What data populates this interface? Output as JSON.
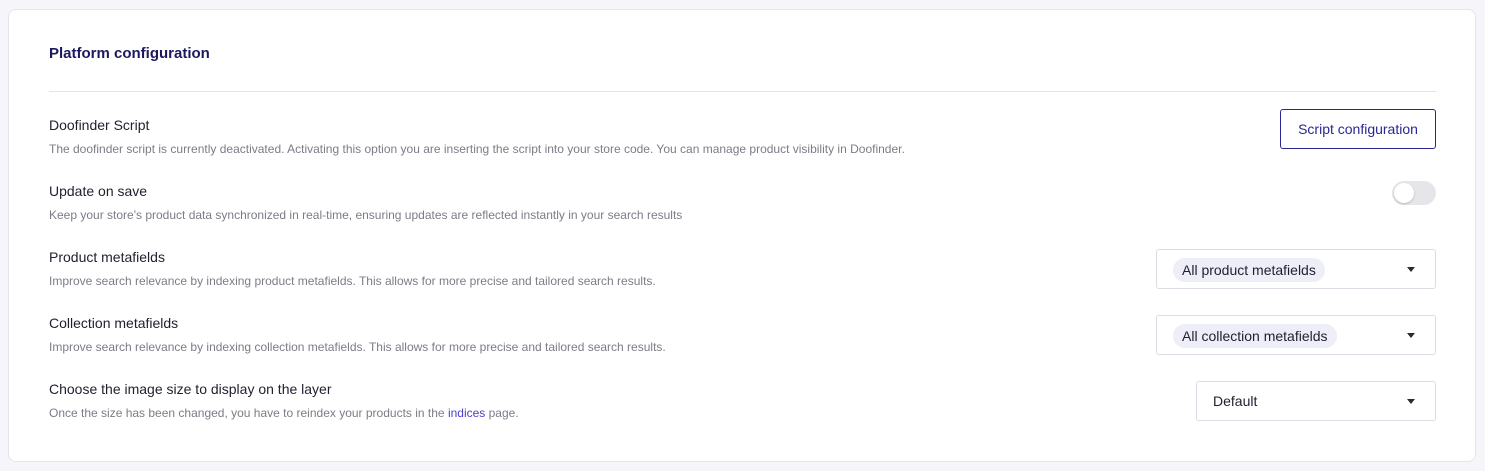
{
  "card": {
    "title": "Platform configuration"
  },
  "settings": [
    {
      "title": "Doofinder Script",
      "description": "The doofinder script is currently deactivated. Activating this option you are inserting the script into your store code. You can manage product visibility in Doofinder.",
      "control": {
        "type": "button",
        "label": "Script configuration"
      }
    },
    {
      "title": "Update on save",
      "description": "Keep your store's product data synchronized in real-time, ensuring updates are reflected instantly in your search results",
      "control": {
        "type": "toggle",
        "checked": false
      }
    },
    {
      "title": "Product metafields",
      "description": "Improve search relevance by indexing product metafields. This allows for more precise and tailored search results.",
      "control": {
        "type": "select",
        "value": "All product metafields"
      }
    },
    {
      "title": "Collection metafields",
      "description": "Improve search relevance by indexing collection metafields. This allows for more precise and tailored search results.",
      "control": {
        "type": "select",
        "value": "All collection metafields"
      }
    },
    {
      "title": "Choose the image size to display on the layer",
      "description_before": "Once the size has been changed, you have to reindex your products in the ",
      "description_link": "indices",
      "description_after": " page.",
      "control": {
        "type": "select",
        "value": "Default"
      }
    }
  ],
  "colors": {
    "accent": "#2c2690",
    "title": "#1c1860",
    "link": "#4a40c8",
    "toggle_off": "#e6e6ea"
  },
  "icons": {
    "select_caret": "caret-down-icon"
  }
}
